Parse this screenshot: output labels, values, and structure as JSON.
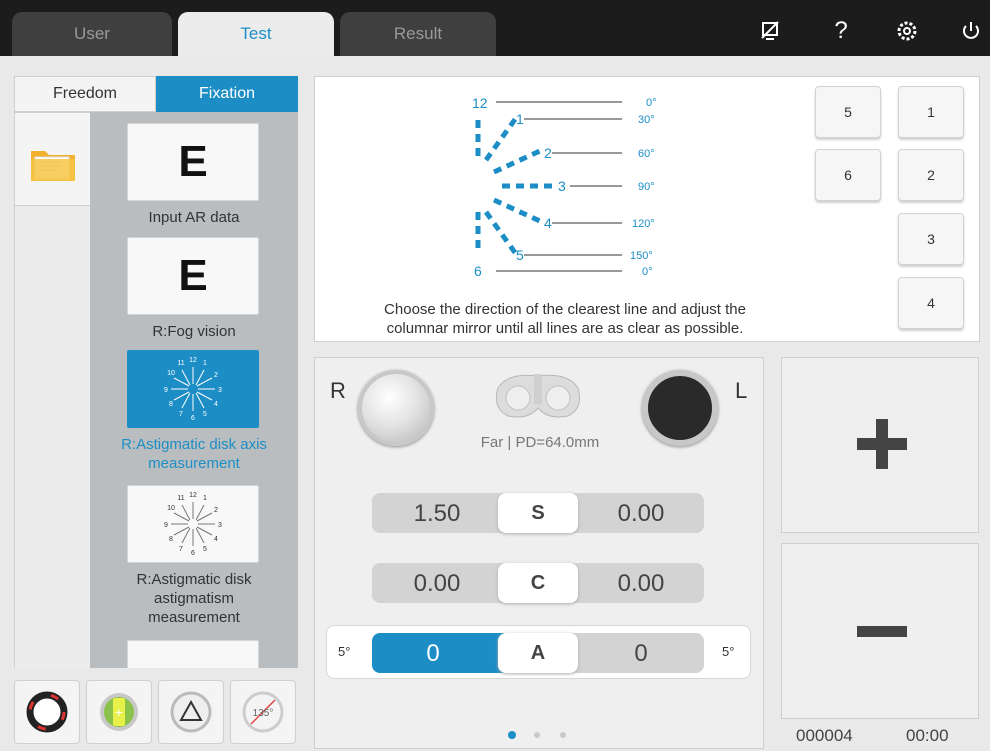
{
  "tabs": [
    {
      "label": "User"
    },
    {
      "label": "Test"
    },
    {
      "label": "Result"
    }
  ],
  "top_icons": [
    "signal-off-icon",
    "help-icon",
    "settings-icon",
    "power-icon"
  ],
  "mode": {
    "freedom": "Freedom",
    "fixation": "Fixation"
  },
  "tests": [
    {
      "label": "Input AR data"
    },
    {
      "label": "R:Fog vision"
    },
    {
      "label": "R:Astigmatic disk axis measurement"
    },
    {
      "label": "R:Astigmatic disk astigmatism measurement"
    }
  ],
  "chart": {
    "numbers": [
      "12",
      "1",
      "2",
      "3",
      "4",
      "5",
      "6"
    ],
    "degrees": [
      "0°",
      "30°",
      "60°",
      "90°",
      "120°",
      "150°",
      "0°"
    ],
    "instruction_line1": "Choose the direction of the clearest line and adjust the",
    "instruction_line2": "columnar mirror until all lines are as clear as possible."
  },
  "dial_numbers": [
    "11",
    "12",
    "1",
    "10",
    "2",
    "9",
    "3",
    "8",
    "4",
    "7",
    "6",
    "5"
  ],
  "line_buttons": [
    "5",
    "1",
    "6",
    "2",
    "3",
    "4"
  ],
  "eyes": {
    "right": "R",
    "left": "L",
    "pd_text": "Far | PD=64.0mm"
  },
  "rows": {
    "s": {
      "key": "S",
      "right": "1.50",
      "left": "0.00"
    },
    "c": {
      "key": "C",
      "right": "0.00",
      "left": "0.00"
    },
    "a": {
      "key": "A",
      "right": "0",
      "left": "0",
      "step_left": "5°",
      "step_right": "5°"
    }
  },
  "footer": {
    "code": "000004",
    "time": "00:00"
  },
  "tools": {
    "angle_label": "135°"
  },
  "colors": {
    "accent": "#1c8dc5",
    "dark": "#1c1c1c"
  }
}
